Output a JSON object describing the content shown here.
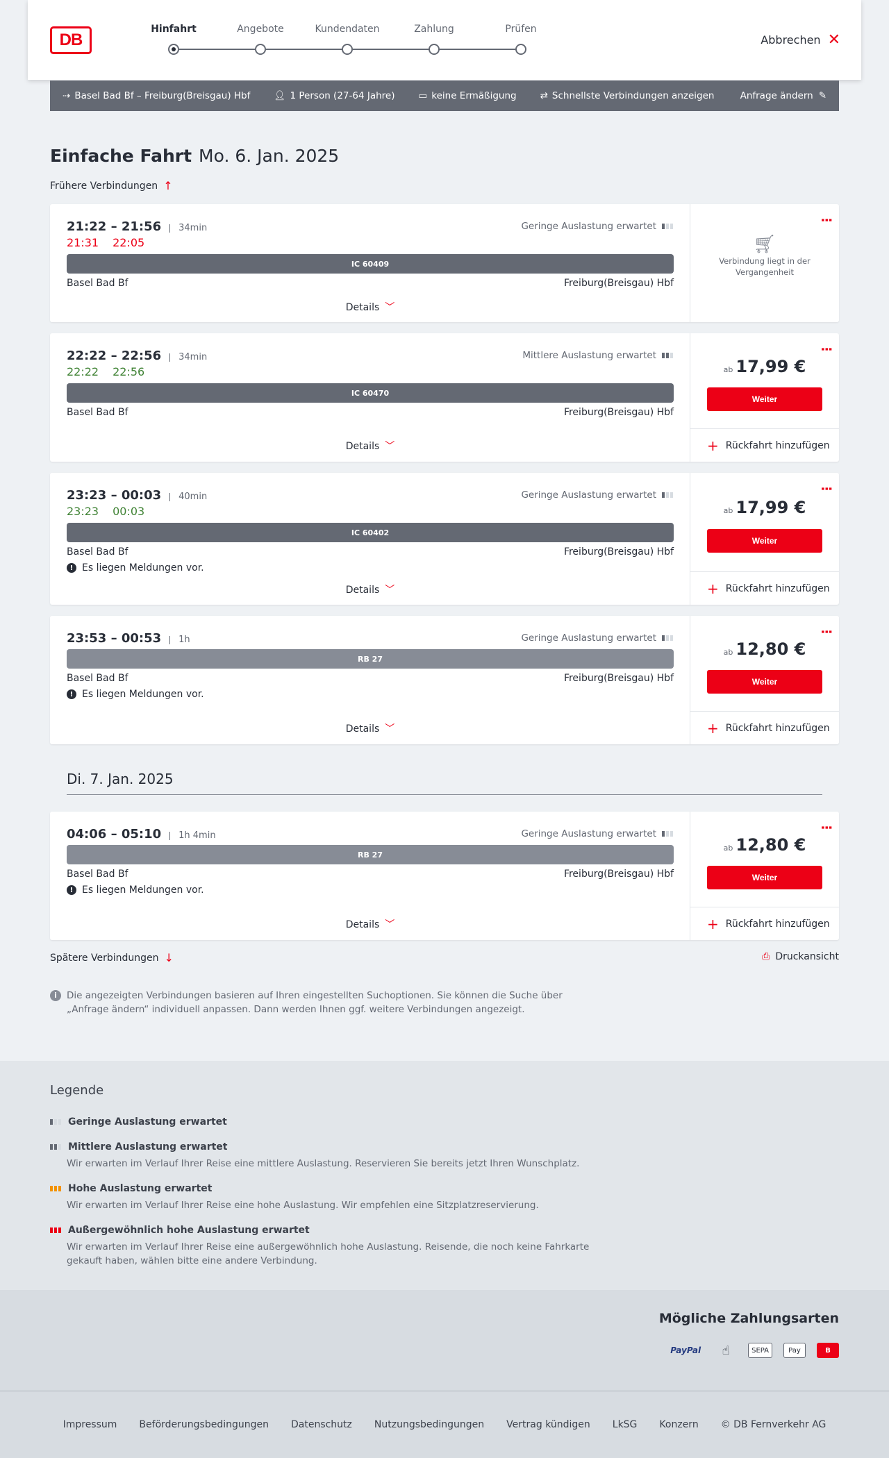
{
  "header": {
    "steps": [
      "Hinfahrt",
      "Angebote",
      "Kundendaten",
      "Zahlung",
      "Prüfen"
    ],
    "cancel_label": "Abbrechen",
    "logo_text": "DB"
  },
  "search": {
    "route": "Basel Bad Bf – Freiburg(Breisgau) Hbf",
    "persons": "1 Person (27-64 Jahre)",
    "discount": "keine Ermäßigung",
    "fastest": "Schnellste Verbindungen anzeigen",
    "edit": "Anfrage ändern"
  },
  "page": {
    "title_bold": "Einfache Fahrt",
    "title_date": "Mo. 6. Jan. 2025",
    "earlier": "Frühere Verbindungen",
    "later": "Spätere Verbindungen",
    "print": "Druckansicht",
    "day2": "Di. 7. Jan. 2025",
    "info": "Die angezeigten Verbindungen basieren auf Ihren eingestellten Suchoptionen. Sie können die Suche über „Anfrage ändern“ individuell anpassen. Dann werden Ihnen ggf. weitere Verbindungen angezeigt."
  },
  "common": {
    "details": "Details",
    "weiter": "Weiter",
    "return": "Rückfahrt hinzufügen",
    "ab": "ab",
    "message": "Es liegen Meldungen vor.",
    "past": "Verbindung liegt in der Vergangenheit",
    "from": "Basel Bad Bf",
    "to": "Freiburg(Breisgau) Hbf"
  },
  "connections": [
    {
      "times": "21:22 – 21:56",
      "duration": "34min",
      "rt_dep": "21:31",
      "rt_arr": "22:05",
      "load": "Geringe Auslastung erwartet",
      "train": "IC 60409"
    },
    {
      "times": "22:22 – 22:56",
      "duration": "34min",
      "rt_dep": "22:22",
      "rt_arr": "22:56",
      "load": "Mittlere Auslastung erwartet",
      "train": "IC 60470",
      "price": "17,99 €"
    },
    {
      "times": "23:23 – 00:03",
      "duration": "40min",
      "rt_dep": "23:23",
      "rt_arr": "00:03",
      "load": "Geringe Auslastung erwartet",
      "train": "IC 60402",
      "price": "17,99 €"
    },
    {
      "times": "23:53 – 00:53",
      "duration": "1h",
      "load": "Geringe Auslastung erwartet",
      "train": "RB 27",
      "price": "12,80 €"
    },
    {
      "times": "04:06 – 05:10",
      "duration": "1h 4min",
      "load": "Geringe Auslastung erwartet",
      "train": "RB 27",
      "price": "12,80 €"
    }
  ],
  "legend": {
    "title": "Legende",
    "items": [
      {
        "title": "Geringe Auslastung erwartet",
        "desc": ""
      },
      {
        "title": "Mittlere Auslastung erwartet",
        "desc": "Wir erwarten im Verlauf Ihrer Reise eine mittlere Auslastung. Reservieren Sie bereits jetzt Ihren Wunschplatz."
      },
      {
        "title": "Hohe Auslastung erwartet",
        "desc": "Wir erwarten im Verlauf Ihrer Reise eine hohe Auslastung. Wir empfehlen eine Sitzplatzreservierung."
      },
      {
        "title": "Außergewöhnlich hohe Auslastung erwartet",
        "desc": "Wir erwarten im Verlauf Ihrer Reise eine außergewöhnlich hohe Auslastung. Reisende, die noch keine Fahrkarte gekauft haben, wählen bitte eine andere Verbindung."
      }
    ]
  },
  "payment": {
    "title": "Mögliche Zahlungsarten",
    "paypal": "PayPal",
    "sepa": "SEPA",
    "applepay": "Pay"
  },
  "footer": [
    "Impressum",
    "Beförderungsbedingungen",
    "Datenschutz",
    "Nutzungsbedingungen",
    "Vertrag kündigen",
    "LkSG",
    "Konzern",
    "© DB Fernverkehr AG"
  ],
  "colors": {
    "brand": "#ec0016",
    "late": "#ec0016",
    "ontime": "#408335",
    "bar": "#646973"
  }
}
